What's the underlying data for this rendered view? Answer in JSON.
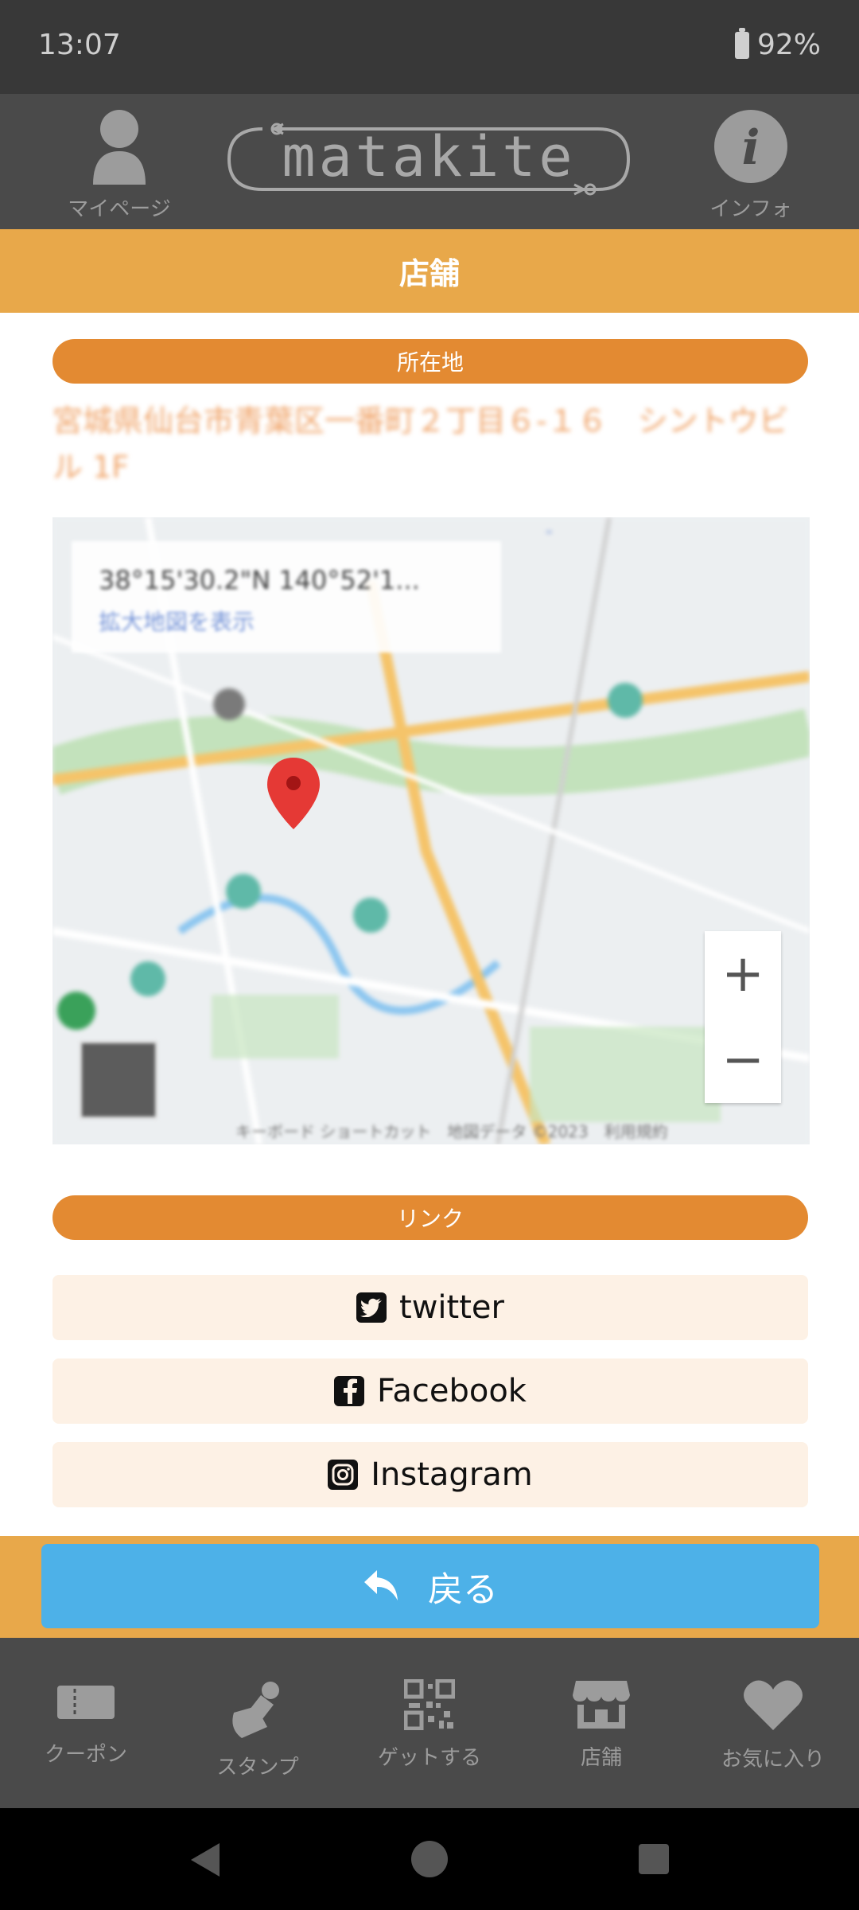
{
  "status_bar": {
    "time": "13:07",
    "battery": "92%"
  },
  "header": {
    "mypage_label": "マイページ",
    "logo_text": "matakite",
    "info_label": "インフォ"
  },
  "page": {
    "title": "店舗"
  },
  "location": {
    "section_label": "所在地",
    "address": "宮城県仙台市青葉区一番町２丁目６-１６　シントウビル 1F"
  },
  "map": {
    "coordinates": "38°15'30.2\"N 140°52'1...",
    "view_larger": "拡大地図を表示",
    "zoom_in": "+",
    "zoom_out": "−",
    "footer": "キーボード ショートカット　地図データ ©2023　利用規約"
  },
  "links": {
    "section_label": "リンク",
    "items": [
      {
        "label": "twitter",
        "icon": "twitter-icon"
      },
      {
        "label": "Facebook",
        "icon": "facebook-icon"
      },
      {
        "label": "Instagram",
        "icon": "instagram-icon"
      }
    ]
  },
  "back": {
    "label": "戻る"
  },
  "bottom_nav": {
    "items": [
      {
        "label": "クーポン",
        "icon": "coupon-icon"
      },
      {
        "label": "スタンプ",
        "icon": "stamp-icon"
      },
      {
        "label": "ゲットする",
        "icon": "qr-code-icon"
      },
      {
        "label": "店舗",
        "icon": "store-icon"
      },
      {
        "label": "お気に入り",
        "icon": "heart-icon"
      }
    ]
  },
  "colors": {
    "accent_orange": "#e8a84a",
    "pill_orange": "#e38a32",
    "back_blue": "#4db1e8",
    "header_dark": "#4a4a4a"
  }
}
